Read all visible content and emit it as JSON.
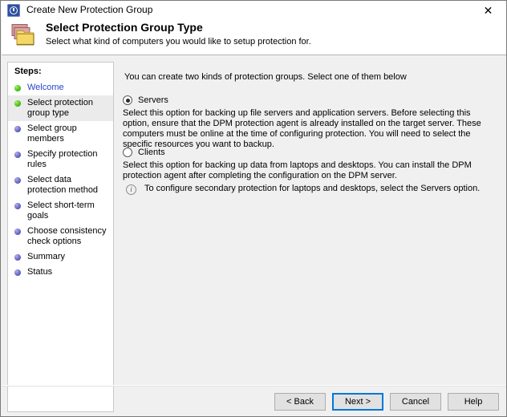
{
  "window": {
    "title": "Create New Protection Group",
    "title_icon": "dpm-clock-icon",
    "close_label": "✕"
  },
  "header": {
    "icon": "folder-group-icon",
    "title": "Select Protection Group Type",
    "subtitle": "Select what kind of computers you would like to setup protection for."
  },
  "sidebar": {
    "label": "Steps:",
    "items": [
      {
        "label": "Welcome",
        "state": "done",
        "link": true,
        "highlight": false
      },
      {
        "label": "Select protection group type",
        "state": "done",
        "link": false,
        "highlight": true
      },
      {
        "label": "Select group members",
        "state": "pending",
        "link": false,
        "highlight": false
      },
      {
        "label": "Specify protection rules",
        "state": "pending",
        "link": false,
        "highlight": false
      },
      {
        "label": "Select data protection method",
        "state": "pending",
        "link": false,
        "highlight": false
      },
      {
        "label": "Select short-term goals",
        "state": "pending",
        "link": false,
        "highlight": false
      },
      {
        "label": "Choose consistency check options",
        "state": "pending",
        "link": false,
        "highlight": false
      },
      {
        "label": "Summary",
        "state": "pending",
        "link": false,
        "highlight": false
      },
      {
        "label": "Status",
        "state": "pending",
        "link": false,
        "highlight": false
      }
    ]
  },
  "main": {
    "intro": "You can create two kinds of protection groups. Select one of them below",
    "options": [
      {
        "id": "servers",
        "label": "Servers",
        "selected": true,
        "description": "Select this option for backing up file servers and application servers. Before selecting this option, ensure that the DPM protection agent is already installed on the target server. These computers must be online at the time of configuring protection. You will need to select the specific resources you want to backup."
      },
      {
        "id": "clients",
        "label": "Clients",
        "selected": false,
        "description": "Select this option for backing up data from laptops and desktops. You can install the DPM protection agent after completing the configuration on the DPM server."
      }
    ],
    "info_note": {
      "icon": "info-icon",
      "glyph": "i",
      "text": "To configure secondary protection for laptops and desktops, select the Servers option."
    }
  },
  "footer": {
    "buttons": [
      {
        "id": "back",
        "label": "< Back",
        "default": false
      },
      {
        "id": "next",
        "label": "Next >",
        "default": true
      },
      {
        "id": "cancel",
        "label": "Cancel",
        "default": false
      },
      {
        "id": "help",
        "label": "Help",
        "default": false
      }
    ]
  },
  "colors": {
    "accent": "#0078d7",
    "link": "#2a44c8",
    "step_done": "#4fc21a",
    "step_pending": "#3b3b96",
    "title_icon": "#2f4f9e"
  }
}
